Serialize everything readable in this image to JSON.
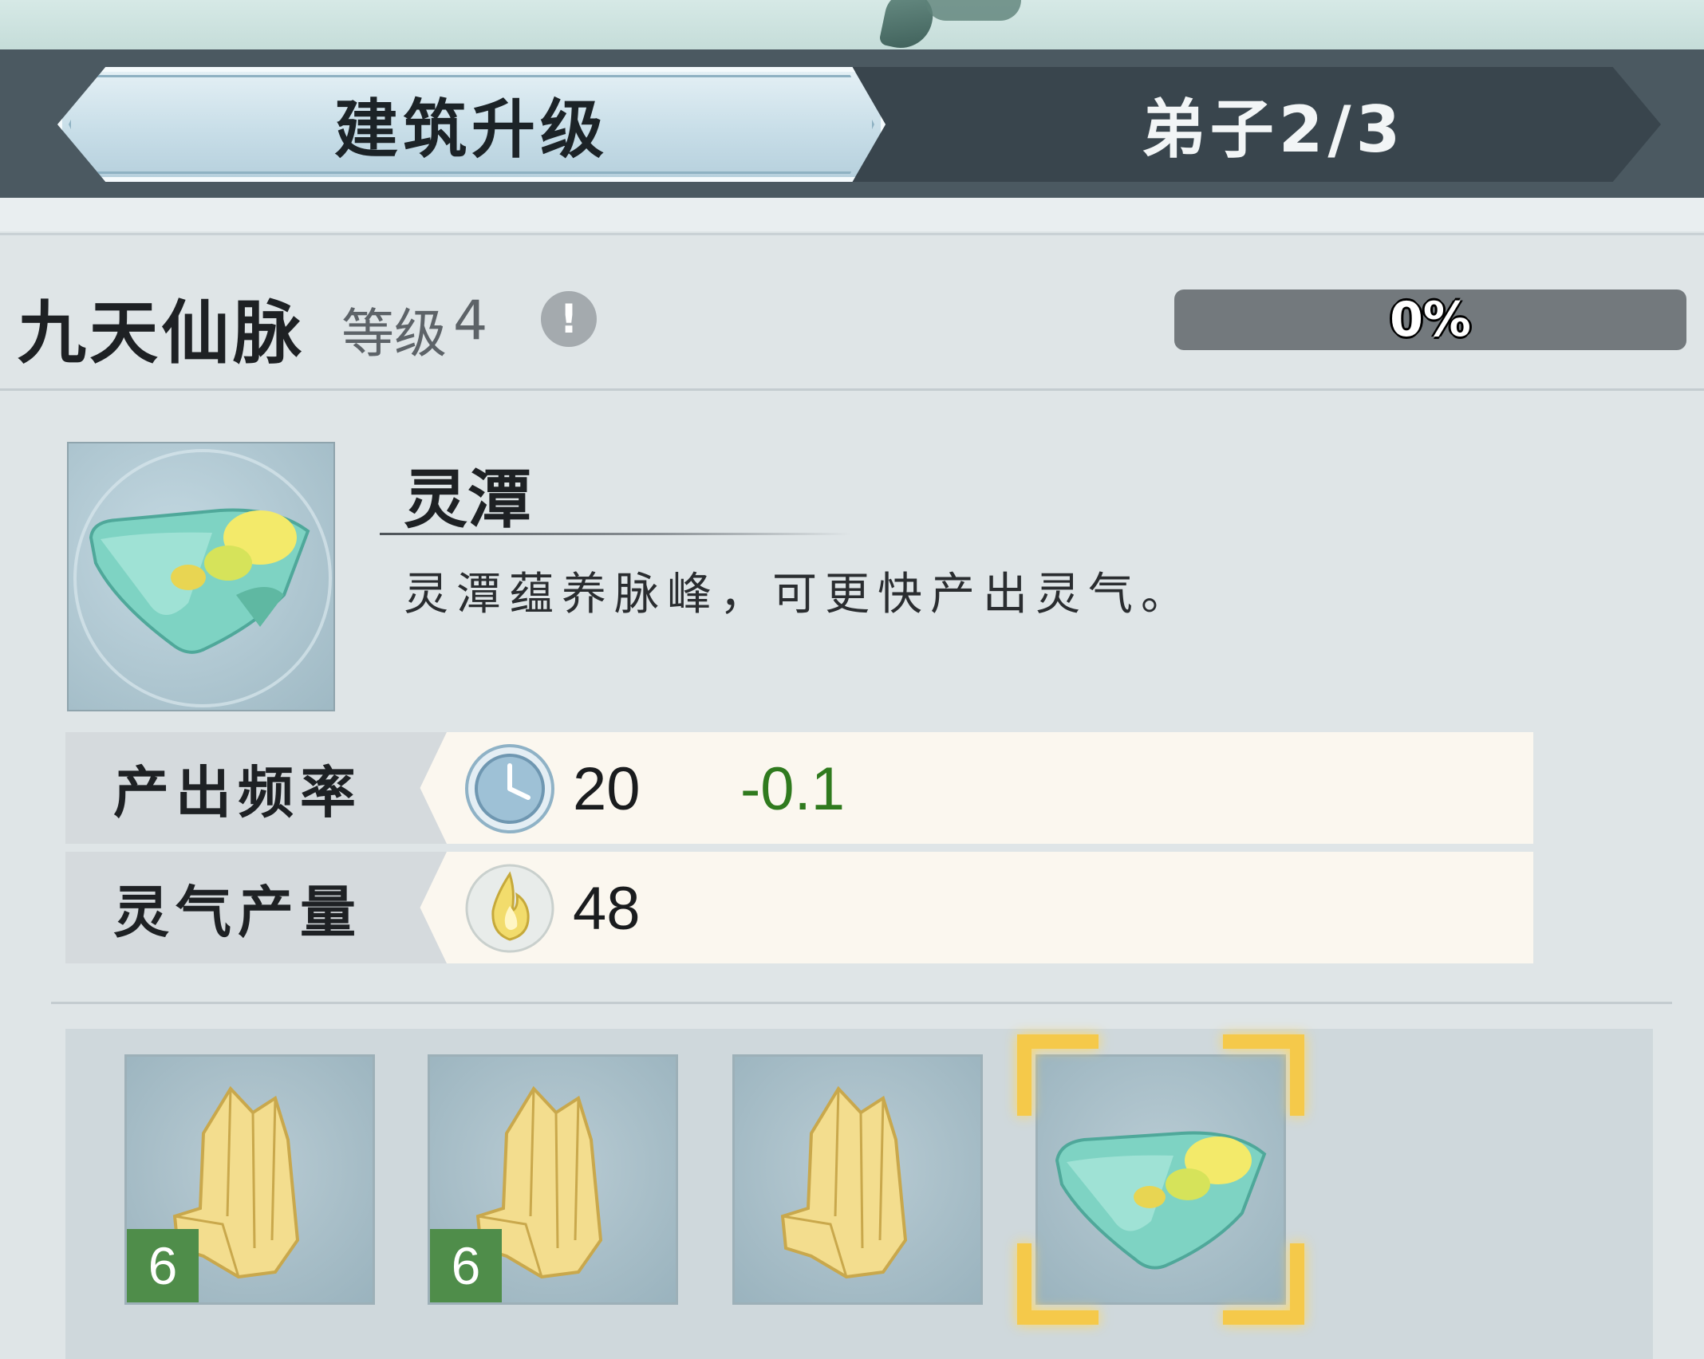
{
  "tabs": [
    {
      "label": "建筑升级",
      "active": true
    },
    {
      "label": "弟子2/3",
      "active": false
    }
  ],
  "header": {
    "title": "九天仙脉",
    "level_label": "等级",
    "level_value": "4",
    "info_icon": "exclamation-icon",
    "progress_text": "0%",
    "progress_value": 0
  },
  "building": {
    "name": "灵潭",
    "description": "灵潭蕴养脉峰，可更快产出灵气。",
    "image_icon": "spirit-pool-icon"
  },
  "stats": [
    {
      "label": "产出频率",
      "icon": "clock-icon",
      "value": "20",
      "delta": "-0.1"
    },
    {
      "label": "灵气产量",
      "icon": "spirit-flame-icon",
      "value": "48",
      "delta": ""
    }
  ],
  "slots": [
    {
      "icon": "crystal-pillar-icon",
      "badge": "6",
      "selected": false
    },
    {
      "icon": "crystal-pillar-icon",
      "badge": "6",
      "selected": false
    },
    {
      "icon": "crystal-pillar-icon",
      "badge": "",
      "selected": false
    },
    {
      "icon": "spirit-pool-icon",
      "badge": "",
      "selected": true
    }
  ],
  "colors": {
    "accent_green": "#2f7a1e",
    "badge_green": "#4f8d4a",
    "selection_gold": "#f5c94a",
    "tab_dark": "#39454d"
  }
}
